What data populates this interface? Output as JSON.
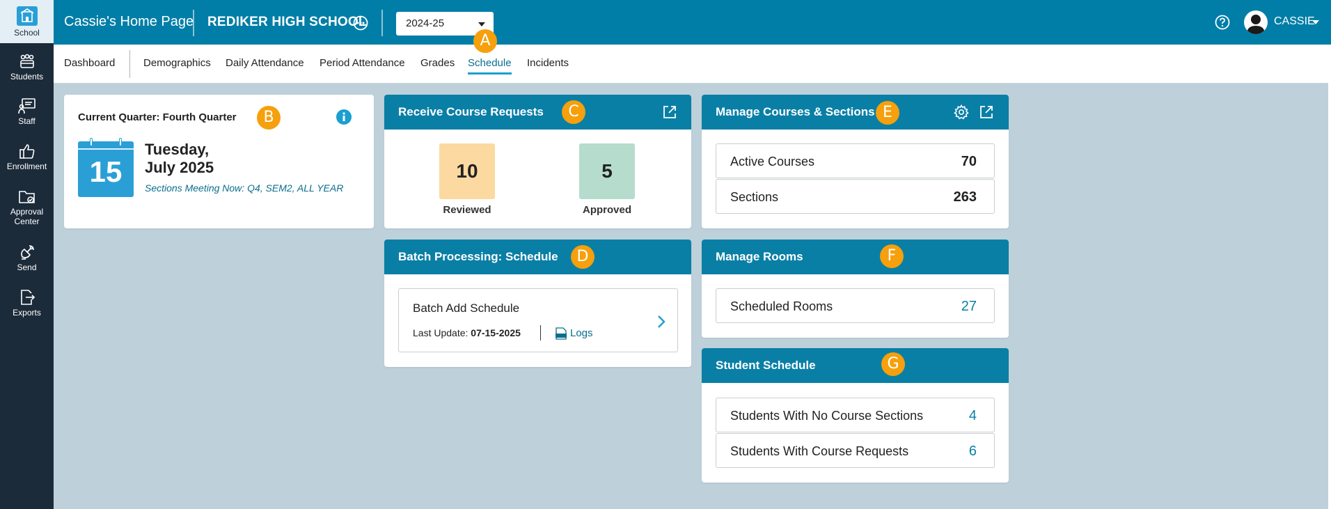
{
  "sidebar": {
    "items": [
      {
        "label": "School",
        "icon": "school-icon"
      },
      {
        "label": "Students",
        "icon": "students-icon"
      },
      {
        "label": "Staff",
        "icon": "staff-icon"
      },
      {
        "label": "Enrollment",
        "icon": "thumbs-up-icon"
      },
      {
        "label": "Approval",
        "label2": "Center",
        "icon": "folder-icon"
      },
      {
        "label": "Send",
        "icon": "satellite-icon"
      },
      {
        "label": "Exports",
        "icon": "export-icon"
      }
    ]
  },
  "header": {
    "home_title": "Cassie's Home Page",
    "school_name": "REDIKER HIGH SCHOOL",
    "year": "2024-25",
    "user_name": "CASSIE"
  },
  "tabs": [
    "Dashboard",
    "Demographics",
    "Daily Attendance",
    "Period Attendance",
    "Grades",
    "Schedule",
    "Incidents"
  ],
  "active_tab": "Schedule",
  "markers": [
    "A",
    "B",
    "C",
    "D",
    "E",
    "F",
    "G"
  ],
  "current_quarter": {
    "title": "Current Quarter: Fourth Quarter",
    "day": "15",
    "weekday": "Tuesday,",
    "month_year": "July 2025",
    "meeting": "Sections Meeting Now: Q4, SEM2, ALL YEAR"
  },
  "course_requests": {
    "title": "Receive Course Requests",
    "reviewed_value": "10",
    "reviewed_label": "Reviewed",
    "approved_value": "5",
    "approved_label": "Approved"
  },
  "batch": {
    "title": "Batch Processing: Schedule",
    "item_title": "Batch Add Schedule",
    "last_update_label": "Last Update:",
    "last_update_value": "07-15-2025",
    "logs_label": "Logs"
  },
  "manage_courses": {
    "title": "Manage Courses & Sections",
    "rows": [
      {
        "label": "Active Courses",
        "value": "70"
      },
      {
        "label": "Sections",
        "value": "263"
      }
    ]
  },
  "manage_rooms": {
    "title": "Manage Rooms",
    "rows": [
      {
        "label": "Scheduled Rooms",
        "value": "27"
      }
    ]
  },
  "student_schedule": {
    "title": "Student Schedule",
    "rows": [
      {
        "label": "Students With No Course Sections",
        "value": "4"
      },
      {
        "label": "Students With Course Requests",
        "value": "6"
      }
    ]
  },
  "colors": {
    "header": "#007ea7",
    "sidebar": "#1c2b3a",
    "background": "#bed1da",
    "marker": "#f5a00c",
    "reviewed": "#fcd9a0",
    "approved": "#b5dccd",
    "calendar": "#2a9fd6"
  }
}
